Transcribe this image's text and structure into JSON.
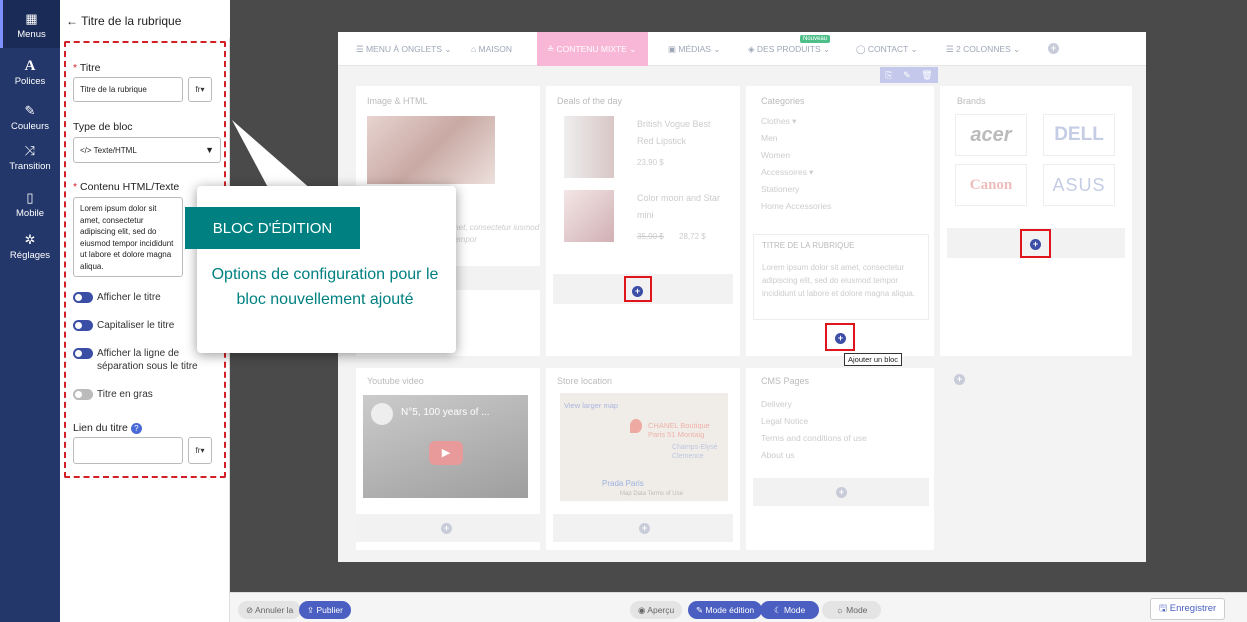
{
  "sidebar": {
    "items": [
      {
        "icon": "grid-icon",
        "label": "Menus"
      },
      {
        "icon": "font-icon",
        "label": "Polices"
      },
      {
        "icon": "brush-icon",
        "label": "Couleurs"
      },
      {
        "icon": "shuffle-icon",
        "label": "Transition"
      },
      {
        "icon": "mobile-icon",
        "label": "Mobile"
      },
      {
        "icon": "gear-icon",
        "label": "Réglages"
      }
    ]
  },
  "panel": {
    "title": "Titre de la rubrique",
    "titre_label": "Titre",
    "titre_value": "Titre de la rubrique",
    "lang": "fr",
    "type_label": "Type de bloc",
    "type_value": "</> Texte/HTML",
    "contenu_label": "Contenu HTML/Texte",
    "contenu_value": "Lorem ipsum dolor sit amet, consectetur adipiscing elit, sed do eiusmod tempor incididunt ut labore et dolore magna aliqua.",
    "toggles": [
      {
        "label": "Afficher le titre",
        "on": true
      },
      {
        "label": "Capitaliser le titre",
        "on": true
      },
      {
        "label": "Afficher la ligne de séparation sous le titre",
        "on": true
      },
      {
        "label": "Titre en gras",
        "on": false
      }
    ],
    "lien_label": "Lien du titre",
    "lien_lang": "fr"
  },
  "callout": {
    "title": "BLOC D'ÉDITION",
    "body": "Options de configuration pour le bloc nouvellement ajouté"
  },
  "menubar": {
    "items": [
      "☰ MENU À ONGLETS ⌄",
      "⌂ MAISON",
      "≗ CONTENU MIXTE ⌄",
      "▣ MÉDIAS ⌄",
      "◈ DES PRODUITS ⌄",
      "◯ CONTACT ⌄",
      "☰ 2 COLONNES ⌄"
    ],
    "badge": "Nouveau"
  },
  "blocks": {
    "col1_title": "Image & HTML",
    "col1_text": "met, consectetur iusmod tempor",
    "col2_title": "Deals of the day",
    "prod1_name": "British Vogue Best Red Lipstick",
    "prod1_price": "23,90 $",
    "prod2_name": "Color moon and Star mini",
    "prod2_old": "35,90 $",
    "prod2_price": "28,72 $",
    "col3_title": "Categories",
    "categories": [
      "Clothes ▾",
      "Men",
      "Women",
      "Accessoires ▾",
      "Stationery",
      "Home Accessories"
    ],
    "section_title": "TITRE DE LA RUBRIQUE",
    "section_text": "Lorem ipsum dolor sit amet, consectetur adipiscing elit, sed do eiusmod tempor incididunt ut labore et dolore magna aliqua.",
    "add_tooltip": "Ajouter un bloc",
    "col4_title": "Brands",
    "brands": [
      "acer",
      "DELL",
      "Canon",
      "ASUS"
    ],
    "row2_col1_title": "Youtube video",
    "video_title": "N°5, 100 years of ...",
    "row2_col2_title": "Store location",
    "map_link": "View larger map",
    "map_place1": "CHANEL Boutique Paris 51 Montaig",
    "map_place2": "Champs-Elysé Clemence",
    "map_place3": "Prada Paris",
    "map_footer": "Map Data   Terms of Use",
    "row2_col3_title": "CMS Pages",
    "cms": [
      "Delivery",
      "Legal Notice",
      "Terms and conditions of use",
      "About us"
    ]
  },
  "bottombar": {
    "undo": "⊘ Annuler la",
    "publish": "⇪ Publier",
    "preview": "◉ Aperçu",
    "edit_mode": "✎ Mode édition",
    "dark_mode": "☾ Mode",
    "light_mode": "☼ Mode",
    "save": "🖫 Enregistrer"
  },
  "colors": {
    "nav": "#23376a",
    "accent": "#3c4ea5",
    "callout": "#008080",
    "highlight": "#e0141b"
  }
}
